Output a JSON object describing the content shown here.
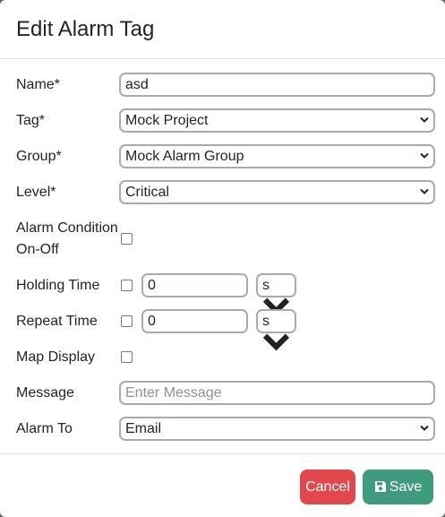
{
  "modal": {
    "title": "Edit Alarm Tag"
  },
  "form": {
    "name": {
      "label": "Name*",
      "value": "asd"
    },
    "tag": {
      "label": "Tag*",
      "value": "Mock Project"
    },
    "group": {
      "label": "Group*",
      "value": "Mock Alarm Group"
    },
    "level": {
      "label": "Level*",
      "value": "Critical"
    },
    "alarm_condition": {
      "label_line1": "Alarm Condition",
      "label_line2": "On-Off"
    },
    "holding_time": {
      "label": "Holding Time",
      "value": "0",
      "unit": "s"
    },
    "repeat_time": {
      "label": "Repeat Time",
      "value": "0",
      "unit": "s"
    },
    "map_display": {
      "label": "Map Display"
    },
    "message": {
      "label": "Message",
      "placeholder": "Enter Message"
    },
    "alarm_to": {
      "label": "Alarm To",
      "value": "Email"
    }
  },
  "footer": {
    "cancel_label": "Cancel",
    "save_label": "Save"
  },
  "colors": {
    "cancel": "#e2474d",
    "save": "#3f9b7e",
    "border": "#a7abb0"
  },
  "icons": {
    "select_arrow": "chevron-down-icon",
    "save": "floppy-disk-icon"
  }
}
